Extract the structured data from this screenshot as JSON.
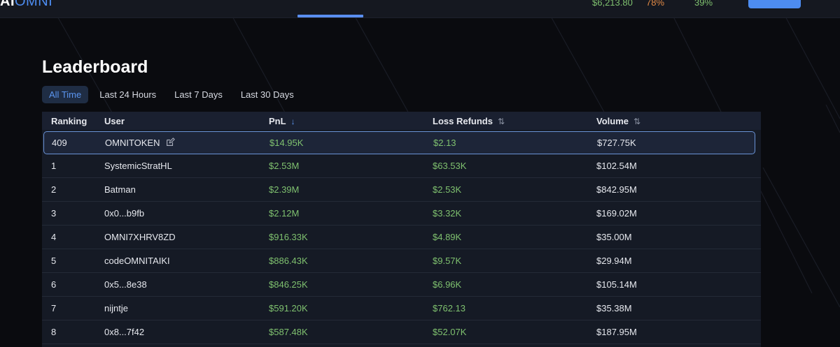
{
  "header": {
    "logo_prefix": "AI",
    "logo_brand": "OMNI",
    "balance": "$6,213.80",
    "stat_orange": "78%",
    "stat_green": "39%"
  },
  "page": {
    "title": "Leaderboard"
  },
  "tabs": [
    {
      "label": "All Time",
      "active": true
    },
    {
      "label": "Last 24 Hours",
      "active": false
    },
    {
      "label": "Last 7 Days",
      "active": false
    },
    {
      "label": "Last 30 Days",
      "active": false
    }
  ],
  "table": {
    "columns": {
      "ranking": "Ranking",
      "user": "User",
      "pnl": "PnL",
      "loss_refunds": "Loss Refunds",
      "volume": "Volume"
    },
    "sort": {
      "column": "pnl",
      "direction": "desc"
    },
    "current_user_row": {
      "rank": "409",
      "user": "OMNITOKEN",
      "pnl": "$14.95K",
      "loss_refunds": "$2.13",
      "volume": "$727.75K"
    },
    "rows": [
      {
        "rank": "1",
        "user": "SystemicStratHL",
        "pnl": "$2.53M",
        "loss_refunds": "$63.53K",
        "volume": "$102.54M"
      },
      {
        "rank": "2",
        "user": "Batman",
        "pnl": "$2.39M",
        "loss_refunds": "$2.53K",
        "volume": "$842.95M"
      },
      {
        "rank": "3",
        "user": "0x0...b9fb",
        "pnl": "$2.12M",
        "loss_refunds": "$3.32K",
        "volume": "$169.02M"
      },
      {
        "rank": "4",
        "user": "OMNI7XHRV8ZD",
        "pnl": "$916.33K",
        "loss_refunds": "$4.89K",
        "volume": "$35.00M"
      },
      {
        "rank": "5",
        "user": "codeOMNITAIKI",
        "pnl": "$886.43K",
        "loss_refunds": "$9.57K",
        "volume": "$29.94M"
      },
      {
        "rank": "6",
        "user": "0x5...8e38",
        "pnl": "$846.25K",
        "loss_refunds": "$6.96K",
        "volume": "$105.14M"
      },
      {
        "rank": "7",
        "user": "nijntje",
        "pnl": "$591.20K",
        "loss_refunds": "$762.13",
        "volume": "$35.38M"
      },
      {
        "rank": "8",
        "user": "0x8...7f42",
        "pnl": "$587.48K",
        "loss_refunds": "$52.07K",
        "volume": "$187.95M"
      }
    ]
  },
  "colors": {
    "background": "#0a0b0f",
    "accent": "#4d8cf0",
    "positive": "#7fc16f",
    "warning": "#e38a45"
  },
  "icons": {
    "sort_active": "arrow-down-icon",
    "sort_idle": "sort-updown-icon",
    "edit": "edit-icon"
  }
}
